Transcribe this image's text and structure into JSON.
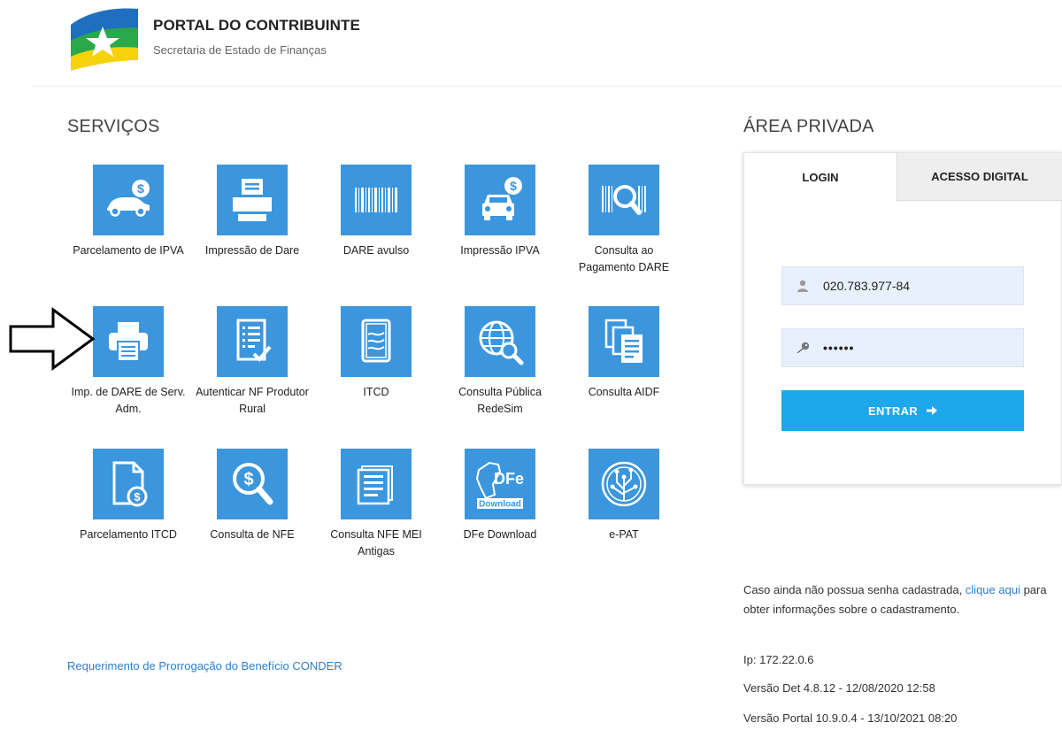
{
  "header": {
    "title": "PORTAL DO CONTRIBUINTE",
    "subtitle": "Secretaria de Estado de Finanças"
  },
  "services": {
    "heading": "SERVIÇOS",
    "items": [
      {
        "label": "Parcelamento de IPVA",
        "icon": "car-money-icon"
      },
      {
        "label": "Impressão de Dare",
        "icon": "printer-icon"
      },
      {
        "label": "DARE avulso",
        "icon": "barcode-icon"
      },
      {
        "label": "Impressão IPVA",
        "icon": "car-front-money-icon"
      },
      {
        "label": "Consulta ao Pagamento DARE",
        "icon": "barcode-search-icon"
      },
      {
        "label": "Imp. de DARE de Serv. Adm.",
        "icon": "printer-document-icon"
      },
      {
        "label": "Autenticar NF Produtor Rural",
        "icon": "checklist-icon"
      },
      {
        "label": "ITCD",
        "icon": "certificate-icon"
      },
      {
        "label": "Consulta Pública RedeSim",
        "icon": "globe-search-icon"
      },
      {
        "label": "Consulta AIDF",
        "icon": "documents-icon"
      },
      {
        "label": "Parcelamento ITCD",
        "icon": "document-money-icon"
      },
      {
        "label": "Consulta de NFE",
        "icon": "money-search-icon"
      },
      {
        "label": "Consulta NFE MEI Antigas",
        "icon": "newspaper-icon"
      },
      {
        "label": "DFe Download",
        "icon": "dfe-download-icon"
      },
      {
        "label": "e-PAT",
        "icon": "tree-circuit-icon"
      }
    ],
    "conder_link": "Requerimento de Prorrogação do Benefício CONDER"
  },
  "private_area": {
    "heading": "ÁREA PRIVADA",
    "tabs": {
      "login": "LOGIN",
      "digital": "ACESSO DIGITAL"
    },
    "username_value": "020.783.977-84",
    "password_value": "••••••",
    "submit_label": "ENTRAR",
    "info_before": "Caso ainda não possua senha cadastrada, ",
    "info_link": "clique aqui",
    "info_after": " para obter informações sobre o cadastramento.",
    "ip": "Ip: 172.22.0.6",
    "version_det": "Versão Det 4.8.12 - 12/08/2020 12:58",
    "version_portal": "Versão Portal 10.9.0.4 - 13/10/2021 08:20"
  },
  "colors": {
    "tile_blue": "#3b96dd",
    "button_blue": "#1ea7ea",
    "link_blue": "#2a7fd0",
    "logo_blue": "#1f6fbf",
    "logo_green": "#2aa84a",
    "logo_yellow": "#f5d20c"
  }
}
